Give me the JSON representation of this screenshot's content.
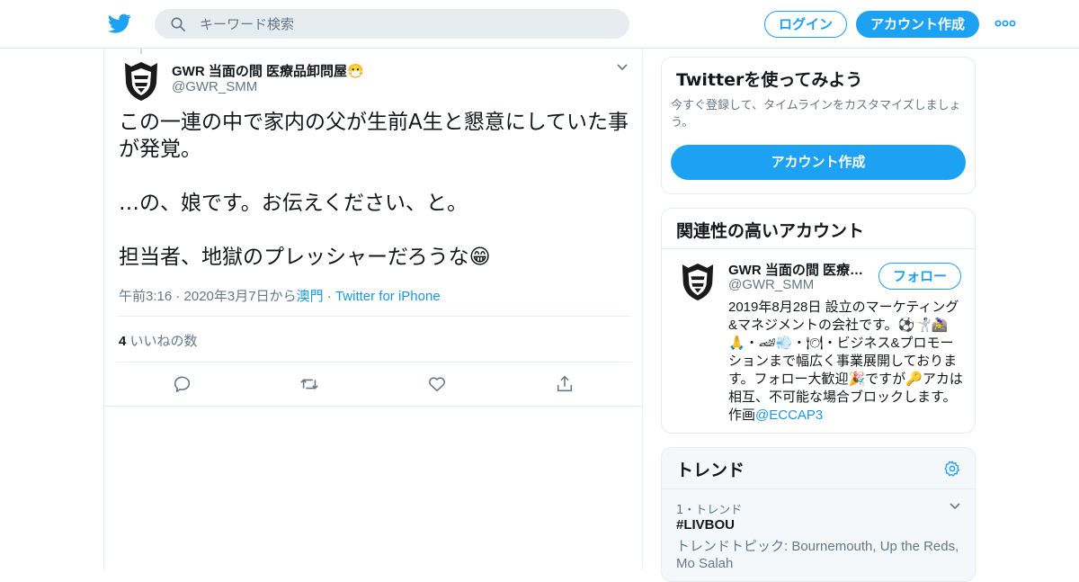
{
  "header": {
    "search_placeholder": "キーワード検索",
    "login_label": "ログイン",
    "signup_label": "アカウント作成",
    "icons": [
      "twitter-bird-icon",
      "search-icon",
      "more-dots-icon"
    ],
    "accent_color": "#1da1f2"
  },
  "tweet": {
    "author_name": "GWR 当面の間 医療品卸問屋😷",
    "author_handle": "@GWR_SMM",
    "text": "この一連の中で家内の父が生前A生と懇意にしていた事が発覚。\n\n…の、娘です。お伝えください、と。\n\n担当者、地獄のプレッシャーだろうな😁",
    "timestamp": "午前3:16 · 2020年3月7日から",
    "location_link": "澳門",
    "separator": " · ",
    "source_link": "Twitter for iPhone",
    "likes_count": "4",
    "likes_label": "いいねの数"
  },
  "signup_card": {
    "title": "Twitterを使ってみよう",
    "description": "今すぐ登録して、タイムラインをカスタマイズしましょう。",
    "button_label": "アカウント作成"
  },
  "related_card": {
    "title": "関連性の高いアカウント",
    "name": "GWR 当面の間 医療品卸問屋😷",
    "handle": "@GWR_SMM",
    "follow_label": "フォロー",
    "bio": "2019年8月28日 設立のマーケティング&マネジメントの会社です。⚽️🤺🚵‍♀️🙏・🏎💨・🍽・ビジネス&プロモーションまで幅広く事業展開しております。フォロー大歓迎🎉ですが🔑アカは相互、不可能な場合ブロックします。作画",
    "bio_link": "@ECCAP3"
  },
  "trends_card": {
    "title": "トレンド",
    "rank_label": "1・トレンド",
    "trend_name": "#LIVBOU",
    "trend_topic": "トレンドトピック: Bournemouth, Up the Reds, Mo Salah"
  }
}
